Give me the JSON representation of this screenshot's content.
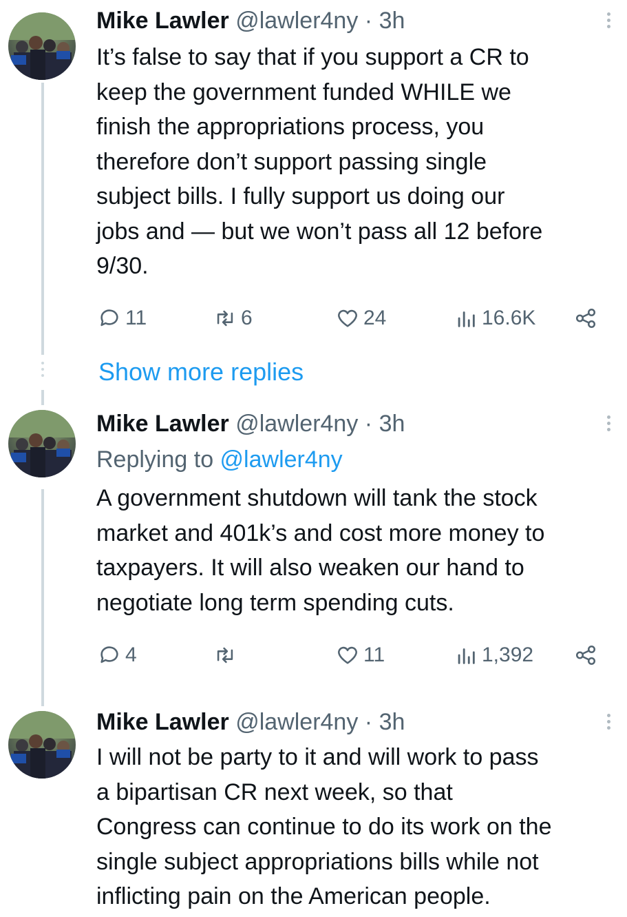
{
  "tweets": [
    {
      "name": "Mike Lawler",
      "handle": "@lawler4ny",
      "time": "· 3h",
      "text": "It’s false to say that if you support a CR to\nkeep the government funded WHILE we\nfinish the appropriations process, you\ntherefore don’t support passing single\nsubject bills. I fully support us doing our\njobs and — but we won’t pass all 12 before\n9/30.",
      "replies": "11",
      "retweets": "6",
      "likes": "24",
      "views": "16.6K"
    },
    {
      "name": "Mike Lawler",
      "handle": "@lawler4ny",
      "time": "· 3h",
      "replying_prefix": "Replying to ",
      "replying_to": "@lawler4ny",
      "text": "A government shutdown will tank the stock\nmarket and 401k’s and cost more money to\ntaxpayers. It will also weaken our hand to\nnegotiate long term spending cuts.",
      "replies": "4",
      "retweets": "",
      "likes": "11",
      "views": "1,392"
    },
    {
      "name": "Mike Lawler",
      "handle": "@lawler4ny",
      "time": "· 3h",
      "text": "I will not be party to it and will work to pass\na bipartisan CR next week, so that\nCongress can continue to do its work on the\nsingle subject appropriations bills while not\ninflicting pain on the American people."
    }
  ],
  "show_more_replies": "Show more replies",
  "colors": {
    "link": "#1d9bf0",
    "secondary": "#536471",
    "thread_line": "#cfd9de"
  },
  "icons": [
    "reply-icon",
    "retweet-icon",
    "like-icon",
    "views-icon",
    "share-icon",
    "more-options-icon"
  ]
}
